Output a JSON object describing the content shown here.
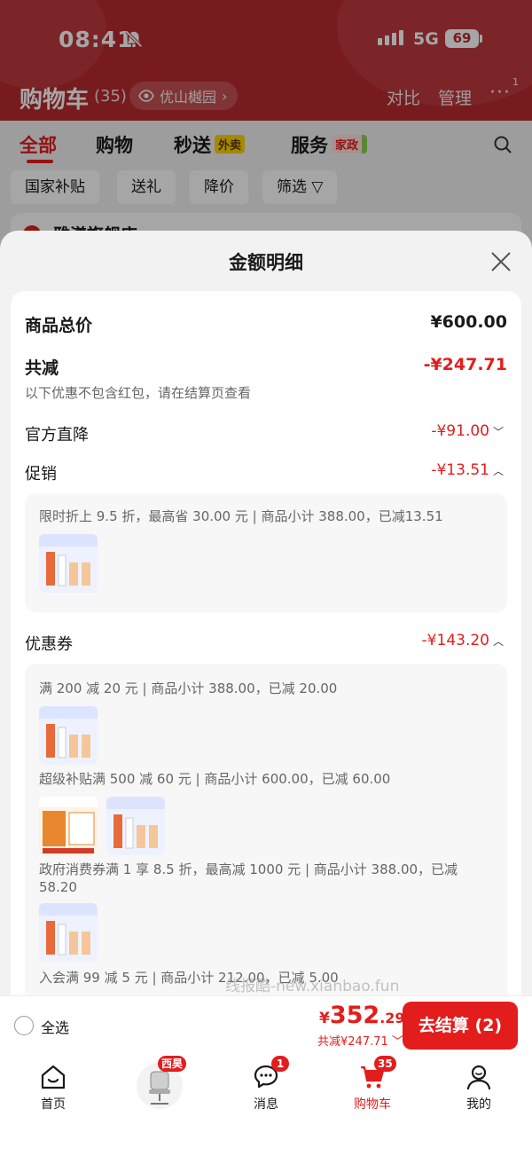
{
  "status_bar": {
    "time": "08:41",
    "network": "5G",
    "battery": "69"
  },
  "header": {
    "title": "购物车",
    "count": "(35)",
    "location": "优山樾园",
    "compare_label": "对比",
    "manage_label": "管理",
    "more_badge": "1"
  },
  "tabs": [
    {
      "label": "全部"
    },
    {
      "label": "购物"
    },
    {
      "label": "秒送",
      "tag": "外卖"
    },
    {
      "label": "服务",
      "tag": "家政"
    }
  ],
  "filters": [
    "国家补贴",
    "送礼",
    "降价",
    "筛选"
  ],
  "store": {
    "name": "雅漾旗舰店"
  },
  "sheet": {
    "title": "金额明细",
    "total_label": "商品总价",
    "total_value": "¥600.00",
    "discount_label": "共减",
    "discount_value": "-¥247.71",
    "discount_note": "以下优惠不包含红包，请在结算页查看",
    "official_label": "官方直降",
    "official_value": "-¥91.00",
    "promo_label": "促销",
    "promo_value": "-¥13.51",
    "promo_rule": "限时折上 9.5 折，最高省 30.00 元 | 商品小计 388.00，已减13.51",
    "coupon_label": "优惠券",
    "coupon_value": "-¥143.20",
    "coupon_rules": [
      "满 200 减 20 元 | 商品小计 388.00，已减 20.00",
      "超级补贴满 500 减 60 元 | 商品小计 600.00，已减 60.00",
      "政府消费券满 1 享 8.5 折，最高减 1000 元 | 商品小计 388.00，已减 58.20",
      "入会满 99 减 5 元 | 商品小计 212.00，已减 5.00"
    ]
  },
  "checkout": {
    "select_all": "全选",
    "price_currency": "¥",
    "price_int": "352",
    "price_dec": ".29",
    "discount_total": "共减¥247.71",
    "button": "去结算 (2)"
  },
  "nav": {
    "home": "首页",
    "avatar_badge": "西昊",
    "messages": "消息",
    "messages_badge": "1",
    "cart": "购物车",
    "cart_badge": "35",
    "mine": "我的"
  },
  "watermark": "线报酷-new.xianbao.fun",
  "colors": {
    "accent": "#e31d1c",
    "header_bg": "#b92a2f"
  }
}
